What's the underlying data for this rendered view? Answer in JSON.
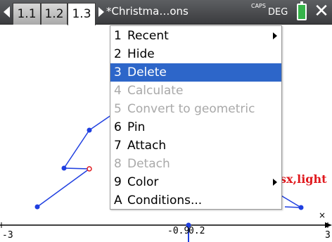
{
  "topbar": {
    "tabs": [
      "1.1",
      "1.2",
      "1.3"
    ],
    "document_title": "*Christma…ons",
    "caps": "CAPS",
    "angle_mode": "DEG",
    "close_glyph": "✕"
  },
  "graph": {
    "x_min_label": "-3",
    "x_max_label": "3",
    "trace_value": "-0.9",
    "trace_value_2": "0.2",
    "function_label": "sx,light",
    "scroll_glyph": "×",
    "colors": {
      "plot": "#1f3fe0",
      "label": "#e0191e",
      "axis": "#000000"
    }
  },
  "menu": {
    "items": [
      {
        "key": "1",
        "label": "Recent",
        "enabled": true,
        "submenu": true
      },
      {
        "key": "2",
        "label": "Hide",
        "enabled": true,
        "submenu": false
      },
      {
        "key": "3",
        "label": "Delete",
        "enabled": true,
        "submenu": false,
        "selected": true
      },
      {
        "key": "4",
        "label": "Calculate",
        "enabled": false,
        "submenu": false
      },
      {
        "key": "5",
        "label": "Convert to geometric",
        "enabled": false,
        "submenu": false
      },
      {
        "key": "6",
        "label": "Pin",
        "enabled": true,
        "submenu": false
      },
      {
        "key": "7",
        "label": "Attach",
        "enabled": true,
        "submenu": false
      },
      {
        "key": "8",
        "label": "Detach",
        "enabled": false,
        "submenu": false
      },
      {
        "key": "9",
        "label": "Color",
        "enabled": true,
        "submenu": true
      },
      {
        "key": "A",
        "label": "Conditions...",
        "enabled": true,
        "submenu": false
      }
    ],
    "highlight_color": "#2d66c9"
  }
}
